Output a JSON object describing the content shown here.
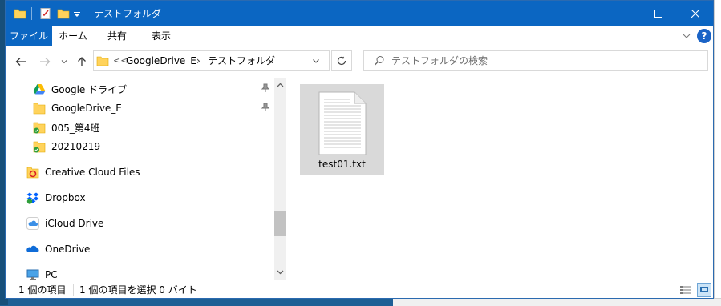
{
  "window": {
    "title": "テストフォルダ"
  },
  "ribbon": {
    "tabs": [
      "ファイル",
      "ホーム",
      "共有",
      "表示"
    ]
  },
  "address": {
    "crumbs": [
      "GoogleDrive_E",
      "テストフォルダ"
    ],
    "overflow": "<<"
  },
  "search": {
    "placeholder": "テストフォルダの検索"
  },
  "nav": {
    "items": [
      {
        "label": "Google ドライブ",
        "icon": "google-drive-icon",
        "pinned": true
      },
      {
        "label": "GoogleDrive_E",
        "icon": "folder-icon",
        "pinned": true
      },
      {
        "label": "005_第4班",
        "icon": "synced-folder-icon",
        "pinned": false
      },
      {
        "label": "20210219",
        "icon": "synced-folder-icon",
        "pinned": false
      },
      {
        "label": "Creative Cloud Files",
        "icon": "creative-cloud-icon",
        "pinned": false
      },
      {
        "label": "Dropbox",
        "icon": "dropbox-icon",
        "pinned": false
      },
      {
        "label": "iCloud Drive",
        "icon": "icloud-icon",
        "pinned": false
      },
      {
        "label": "OneDrive",
        "icon": "onedrive-icon",
        "pinned": false
      },
      {
        "label": "PC",
        "icon": "pc-icon",
        "pinned": false
      }
    ]
  },
  "files": [
    {
      "name": "test01.txt",
      "icon": "text-file-icon",
      "selected": true
    }
  ],
  "status": {
    "count": "1 個の項目",
    "selection": "1 個の項目を選択  0 バイト"
  },
  "colors": {
    "titlebar": "#0b66c2",
    "selection": "#d9d9d9",
    "accent": "#1a63c6"
  }
}
